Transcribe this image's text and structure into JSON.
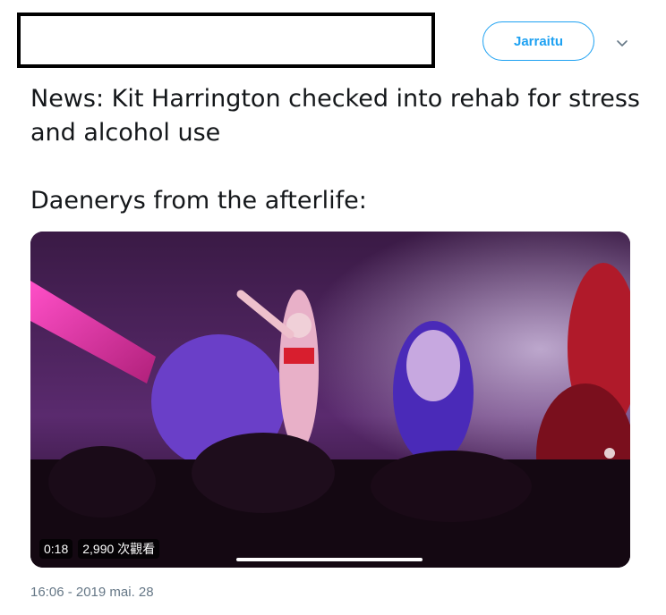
{
  "header": {
    "follow_label": "Jarraitu",
    "caret_icon": "chevron-down-icon",
    "accent_color": "#1da1f2"
  },
  "tweet": {
    "line1": "News: Kit Harrington checked into rehab for stress and alcohol use",
    "line2": "Daenerys from the afterlife:",
    "timestamp": "16:06 - 2019 mai. 28"
  },
  "video": {
    "duration": "0:18",
    "views": "2,990 次觀看",
    "progress_fraction": 0.0
  }
}
